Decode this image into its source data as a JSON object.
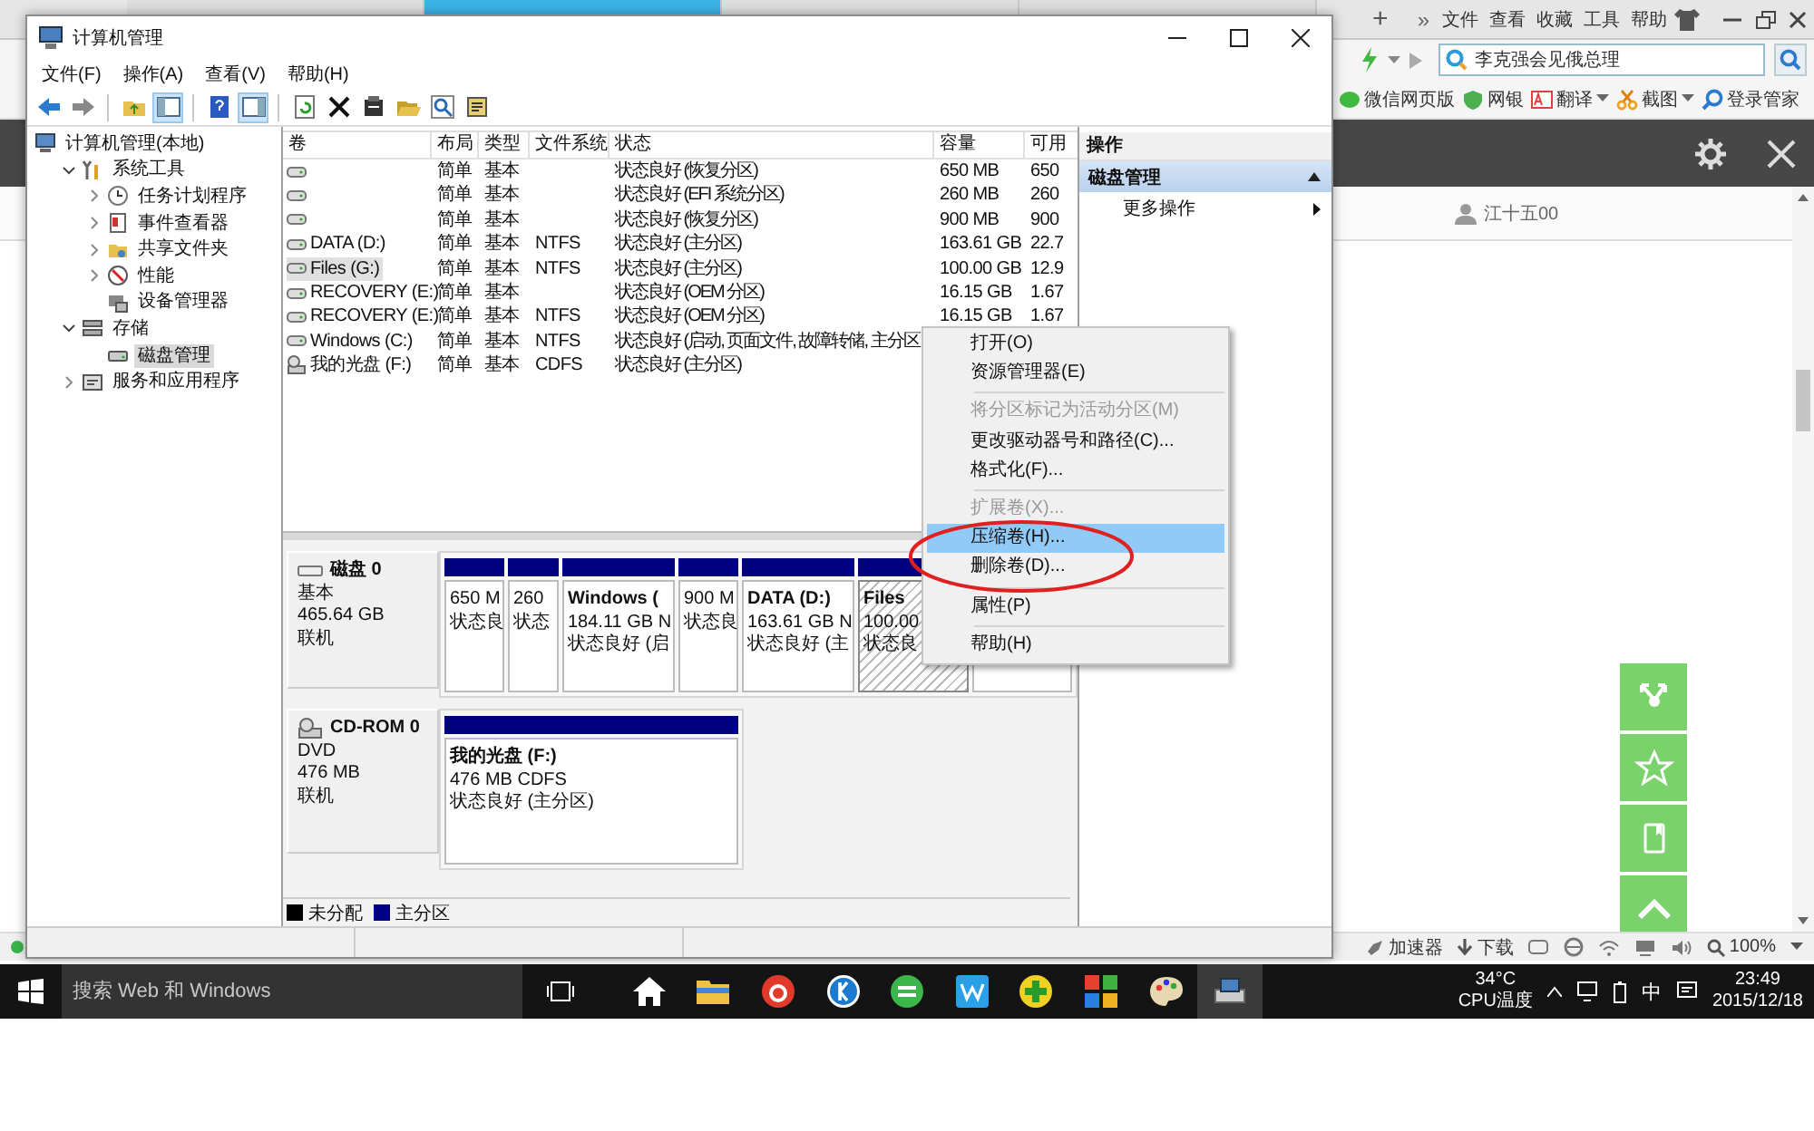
{
  "browser": {
    "tabs": [
      {
        "selected": false
      },
      {
        "selected": true
      },
      {
        "selected": false
      },
      {
        "selected": false
      }
    ],
    "new_tab": "+",
    "more": "»",
    "menu": [
      "文件",
      "查看",
      "收藏",
      "工具",
      "帮助"
    ],
    "search": {
      "value": "李克强会见俄总理"
    },
    "bookmarks": [
      {
        "label": "微信网页版",
        "has_menu": false
      },
      {
        "label": "网银",
        "has_menu": false
      },
      {
        "label": "翻译",
        "has_menu": true
      },
      {
        "label": "截图",
        "has_menu": true
      },
      {
        "label": "登录管家",
        "has_menu": false
      }
    ],
    "user": "江十五00",
    "status_bar": {
      "accelerator": "加速器",
      "download": "下载",
      "zoom": "100%"
    }
  },
  "mmc": {
    "title": "计算机管理",
    "menu": [
      "文件(F)",
      "操作(A)",
      "查看(V)",
      "帮助(H)"
    ],
    "toolbar": [
      {
        "kind": "button",
        "pressed": false
      },
      {
        "kind": "button",
        "pressed": false
      },
      {
        "kind": "separator"
      },
      {
        "kind": "button",
        "pressed": false
      },
      {
        "kind": "button",
        "pressed": true
      },
      {
        "kind": "separator"
      },
      {
        "kind": "button",
        "pressed": false
      },
      {
        "kind": "button",
        "pressed": true
      },
      {
        "kind": "separator"
      },
      {
        "kind": "button",
        "pressed": false
      },
      {
        "kind": "button",
        "pressed": false
      },
      {
        "kind": "button",
        "pressed": false
      },
      {
        "kind": "button",
        "pressed": false
      },
      {
        "kind": "button",
        "pressed": false
      },
      {
        "kind": "button",
        "pressed": false
      }
    ],
    "tree": [
      {
        "label": "计算机管理(本地)",
        "selected": false,
        "children": [
          {
            "label": "系统工具",
            "expanded": true,
            "selected": false,
            "children": [
              {
                "label": "任务计划程序",
                "expanded": false,
                "selected": false
              },
              {
                "label": "事件查看器",
                "expanded": false,
                "selected": false
              },
              {
                "label": "共享文件夹",
                "expanded": false,
                "selected": false
              },
              {
                "label": "性能",
                "expanded": false,
                "selected": false
              },
              {
                "label": "设备管理器",
                "selected": false
              }
            ]
          },
          {
            "label": "存储",
            "expanded": true,
            "selected": false,
            "children": [
              {
                "label": "磁盘管理",
                "selected": true
              }
            ]
          },
          {
            "label": "服务和应用程序",
            "expanded": false,
            "selected": false
          }
        ]
      }
    ],
    "columns": [
      "卷",
      "布局",
      "类型",
      "文件系统",
      "状态",
      "容量",
      "可用"
    ],
    "rows": [
      {
        "kind": "disk",
        "selected": false,
        "layout": "简单",
        "type": "基本",
        "status": "状态良好 (恢复分区)",
        "capacity": "650 MB",
        "free": "650"
      },
      {
        "kind": "disk",
        "selected": false,
        "layout": "简单",
        "type": "基本",
        "status": "状态良好 (EFI 系统分区)",
        "capacity": "260 MB",
        "free": "260"
      },
      {
        "kind": "disk",
        "selected": false,
        "layout": "简单",
        "type": "基本",
        "status": "状态良好 (恢复分区)",
        "capacity": "900 MB",
        "free": "900"
      },
      {
        "kind": "disk",
        "selected": false,
        "volume": "DATA (D:)",
        "layout": "简单",
        "type": "基本",
        "filesystem": "NTFS",
        "status": "状态良好 (主分区)",
        "capacity": "163.61 GB",
        "free": "22.7"
      },
      {
        "kind": "disk",
        "selected": true,
        "volume": "Files (G:)",
        "layout": "简单",
        "type": "基本",
        "filesystem": "NTFS",
        "status": "状态良好 (主分区)",
        "capacity": "100.00 GB",
        "free": "12.9"
      },
      {
        "kind": "disk",
        "selected": false,
        "volume": "RECOVERY (E:)",
        "layout": "简单",
        "type": "基本",
        "status": "状态良好 (OEM 分区)",
        "capacity": "16.15 GB",
        "free": "1.67"
      },
      {
        "kind": "disk",
        "selected": false,
        "volume": "RECOVERY (E:)",
        "layout": "简单",
        "type": "基本",
        "filesystem": "NTFS",
        "status": "状态良好 (OEM 分区)",
        "capacity": "16.15 GB",
        "free": "1.67"
      },
      {
        "kind": "disk",
        "selected": false,
        "volume": "Windows (C:)",
        "layout": "简单",
        "type": "基本",
        "filesystem": "NTFS",
        "status": "状态良好 (启动, 页面文件, 故障转储, 主分区"
      },
      {
        "kind": "cd",
        "selected": false,
        "volume": "我的光盘 (F:)",
        "layout": "简单",
        "type": "基本",
        "filesystem": "CDFS",
        "status": "状态良好 (主分区)"
      }
    ],
    "disks": [
      {
        "kind": "disk",
        "name": "磁盘 0",
        "type": "基本",
        "size": "465.64 GB",
        "state": "联机",
        "partitions": [
          {
            "size": "650 M",
            "status": "状态良",
            "selected": false
          },
          {
            "size": "260",
            "status": "状态",
            "selected": false
          },
          {
            "name": "Windows  (",
            "size": "184.11 GB N",
            "status": "状态良好 (启",
            "selected": false
          },
          {
            "size": "900 M",
            "status": "状态良",
            "selected": false
          },
          {
            "name": "DATA  (D:)",
            "size": "163.61 GB N",
            "status": "状态良好 (主",
            "selected": false
          },
          {
            "name": "Files",
            "size": "100.00",
            "status": "状态良",
            "selected": true
          },
          {
            "selected": false
          }
        ]
      },
      {
        "kind": "cd",
        "name": "CD-ROM 0",
        "type": "DVD",
        "size": "476 MB",
        "state": "联机",
        "partitions": [
          {
            "name": "我的光盘  (F:)",
            "size": "476 MB CDFS",
            "status": "状态良好 (主分区)",
            "selected": false
          }
        ]
      }
    ],
    "legend": [
      {
        "label": "未分配",
        "color": "#000000"
      },
      {
        "label": "主分区",
        "color": "#000080"
      }
    ],
    "actions": {
      "header": "操作",
      "section": "磁盘管理",
      "items": [
        "更多操作"
      ]
    }
  },
  "context_menu": [
    {
      "kind": "item",
      "label": "打开(O)",
      "disabled": false,
      "selected": false
    },
    {
      "kind": "item",
      "label": "资源管理器(E)",
      "disabled": false,
      "selected": false
    },
    {
      "kind": "separator"
    },
    {
      "kind": "item",
      "label": "将分区标记为活动分区(M)",
      "disabled": true,
      "selected": false
    },
    {
      "kind": "item",
      "label": "更改驱动器号和路径(C)...",
      "disabled": false,
      "selected": false
    },
    {
      "kind": "item",
      "label": "格式化(F)...",
      "disabled": false,
      "selected": false
    },
    {
      "kind": "separator"
    },
    {
      "kind": "item",
      "label": "扩展卷(X)...",
      "disabled": true,
      "selected": false
    },
    {
      "kind": "item",
      "label": "压缩卷(H)...",
      "disabled": false,
      "selected": true
    },
    {
      "kind": "item",
      "label": "删除卷(D)...",
      "disabled": false,
      "selected": false
    },
    {
      "kind": "separator"
    },
    {
      "kind": "item",
      "label": "属性(P)",
      "disabled": false,
      "selected": false
    },
    {
      "kind": "separator"
    },
    {
      "kind": "item",
      "label": "帮助(H)",
      "disabled": false,
      "selected": false
    }
  ],
  "taskbar": {
    "search": {
      "placeholder": "搜索 Web 和 Windows"
    },
    "temperature": "34°C",
    "temperature_label": "CPU温度",
    "ime": "中",
    "time": "23:49",
    "date": "2015/12/18"
  }
}
